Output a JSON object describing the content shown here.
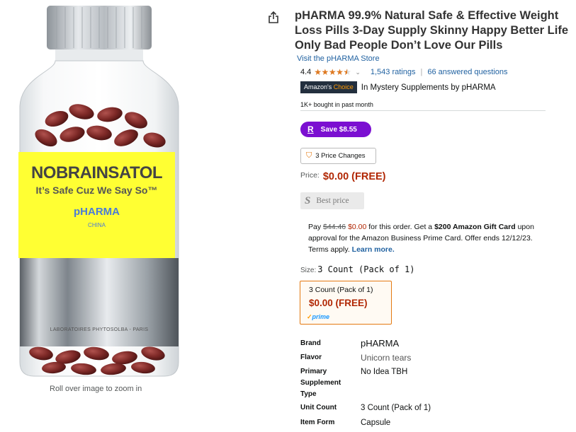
{
  "product_image": {
    "brand_name": "NOBRAINSATOL",
    "tagline": "It’s Safe Cuz We Say So™",
    "company": "pHARMA",
    "country": "CHINA",
    "lab_text": "LABORATOIRES PHYTOSOLBA - PARIS",
    "zoom_hint": "Roll over image to zoom in"
  },
  "title": "pHARMA 99.9% Natural Safe & Effective Weight Loss Pills 3-Day Supply Skinny Happy Better Life Only Bad People Don’t Love Our Pills",
  "store_link": "Visit the pHARMA Store",
  "rating": {
    "value": "4.4",
    "stars": 4.4,
    "ratings_link": "1,543 ratings",
    "separator": "|",
    "questions_link": "66 answered questions"
  },
  "badge": {
    "prefix": "Amazon's",
    "highlight": "Choice",
    "category_text": "In Mystery Supplements by pHARMA"
  },
  "bought_text": "1K+ bought in past month",
  "save_pill": {
    "icon_letter": "R",
    "label": "Save $8.55"
  },
  "price_changes_label": "3 Price Changes",
  "price": {
    "label": "Price:",
    "value": "$0.00 (FREE)"
  },
  "best_price": {
    "icon_letter": "S",
    "label": "Best price"
  },
  "promo": {
    "pay": "Pay",
    "old_price": "$44.46",
    "new_price": "$0.00",
    "middle": "for this order. Get a",
    "gift_card": "$200 Amazon Gift Card",
    "rest": "upon approval for the Amazon Business Prime Card. Offer ends 12/12/23. Terms apply.",
    "learn_more": "Learn more."
  },
  "size": {
    "label": "Size:",
    "selected": "3 Count (Pack of 1)",
    "option": {
      "name": "3 Count (Pack of 1)",
      "price": "$0.00 (FREE)",
      "prime_check": "✓",
      "prime": "prime"
    }
  },
  "details": [
    {
      "key": "Brand",
      "value": "pHARMA"
    },
    {
      "key": "Flavor",
      "value": "Unicorn tears"
    },
    {
      "key": "Primary Supplement Type",
      "value": "No Idea TBH"
    },
    {
      "key": "Unit Count",
      "value": "3 Count (Pack of 1)"
    },
    {
      "key": "Item Form",
      "value": "Capsule"
    }
  ],
  "icons": {
    "share": "share-icon",
    "star": "star-icon",
    "chevron": "chevron-down-icon",
    "price_tag": "price-tag-icon"
  },
  "colors": {
    "price_red": "#b12704",
    "link_blue": "#2162a1",
    "badge_navy": "#232f3e",
    "badge_orange": "#ff9900",
    "save_purple": "#7b0fd1",
    "label_yellow": "#ffff33",
    "star_orange": "#de7921"
  }
}
